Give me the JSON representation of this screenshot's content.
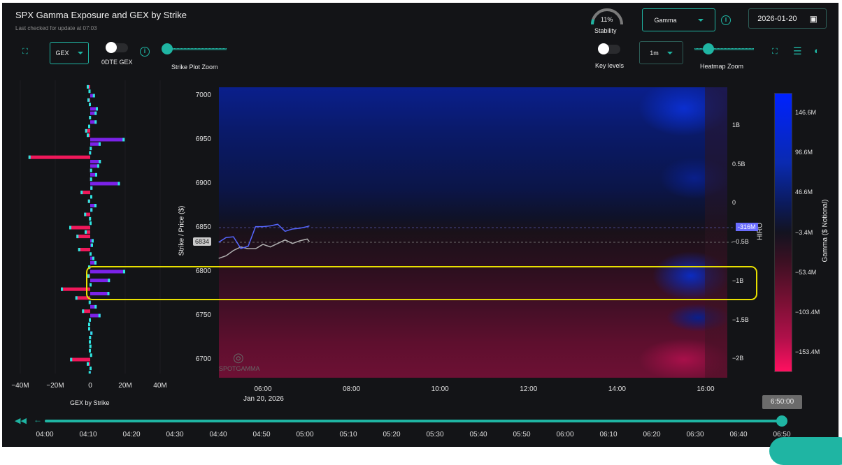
{
  "header": {
    "title": "SPX Gamma Exposure and GEX by Strike",
    "subtitle": "Last checked for update at 07:03"
  },
  "controls_left": {
    "gex_select": "GEX",
    "dte_toggle_label": "0DTE GEX",
    "dte_toggle_on": false,
    "strike_zoom_label": "Strike Plot Zoom",
    "info": "i"
  },
  "controls_right": {
    "stability_value": "11%",
    "stability_label": "Stability",
    "stability_fraction": 0.11,
    "gamma_select": "Gamma",
    "info": "i",
    "date": "2026-01-20",
    "key_levels_label": "Key levels",
    "key_levels_on": false,
    "interval_select": "1m",
    "heatmap_zoom_label": "Heatmap Zoom"
  },
  "colors": {
    "accent": "#1fb5a3",
    "positive_bar": "#7b22e8",
    "negative_bar": "#f0185a",
    "highlight": "#e8e000",
    "hiro_line": "#5566ff",
    "price_line": "#b0b0b0"
  },
  "gex_chart": {
    "type": "bar",
    "title": "GEX by Strike",
    "xlim": [
      -40,
      40
    ],
    "x_ticks": [
      "−40M",
      "−20M",
      "0",
      "20M",
      "40M"
    ],
    "strikes": [
      7010,
      7005,
      7000,
      6995,
      6990,
      6985,
      6980,
      6975,
      6970,
      6965,
      6960,
      6955,
      6950,
      6945,
      6940,
      6935,
      6930,
      6925,
      6920,
      6915,
      6910,
      6905,
      6900,
      6895,
      6890,
      6885,
      6880,
      6875,
      6870,
      6865,
      6860,
      6855,
      6850,
      6845,
      6840,
      6835,
      6830,
      6825,
      6820,
      6815,
      6810,
      6805,
      6800,
      6795,
      6790,
      6785,
      6780,
      6775,
      6770,
      6765,
      6760,
      6755,
      6750,
      6745,
      6740,
      6735,
      6730,
      6725,
      6720,
      6715,
      6710,
      6705,
      6700,
      6695,
      6690,
      6685,
      6680
    ],
    "values_M": [
      -2,
      -1,
      2.7,
      -1.6,
      -0.8,
      4.4,
      3.7,
      -0.7,
      3.7,
      -1.2,
      -2.9,
      -2,
      19.7,
      6,
      0.9,
      0.5,
      -35.3,
      6.1,
      5.2,
      -0.1,
      4,
      -0.1,
      17,
      1.3,
      -5.5,
      1.2,
      -1.3,
      3.6,
      1.3,
      -3.5,
      -0.7,
      0.8,
      -12,
      -3.2,
      -7.9,
      2,
      1.6,
      -6.9,
      -0.4,
      2.4,
      3.6,
      0,
      20,
      -1.6,
      11.3,
      -0.4,
      -16.8,
      11,
      -8.5,
      0.3,
      3.7,
      -4.7,
      5.9,
      0.4,
      -1.2,
      -1.2,
      1.3,
      0.5,
      0.4,
      -0.5,
      -0.8,
      -0.1,
      -11.5,
      -2,
      0.8,
      0.3,
      -0.4
    ]
  },
  "chart_data": {
    "type": "heatmap",
    "ylabel": "Strike / Price ($)",
    "y_ticks": [
      7000,
      6950,
      6900,
      6850,
      6800,
      6750,
      6700
    ],
    "x_ticks": [
      "06:00",
      "08:00",
      "10:00",
      "12:00",
      "14:00",
      "16:00"
    ],
    "x_date": "Jan 20, 2026",
    "y2label": "HIRO",
    "y2_ticks": [
      "1B",
      "0.5B",
      "0",
      "−0.5B",
      "−1B",
      "−1.5B",
      "−2B"
    ],
    "colorbar_label": "Gamma ($ Notional)",
    "colorbar_ticks": [
      "146.6M",
      "96.6M",
      "46.6M",
      "−3.4M",
      "−53.4M",
      "−103.4M",
      "−153.4M"
    ],
    "price_label": "6834",
    "hiro_label": "-316M",
    "price_series": {
      "times": [
        "05:00",
        "05:10",
        "05:20",
        "05:30",
        "05:40",
        "05:50",
        "06:00",
        "06:10",
        "06:20",
        "06:30",
        "06:40",
        "06:50",
        "07:00",
        "07:03"
      ],
      "values": [
        6815,
        6818,
        6824,
        6828,
        6826,
        6826,
        6831,
        6828,
        6832,
        6836,
        6832,
        6835,
        6837,
        6834
      ]
    },
    "hiro_series": {
      "times": [
        "05:00",
        "05:10",
        "05:20",
        "05:30",
        "05:40",
        "05:50",
        "06:00",
        "06:10",
        "06:20",
        "06:30",
        "06:40",
        "06:50",
        "07:00",
        "07:03"
      ],
      "values_B": [
        -0.5,
        -0.44,
        -0.43,
        -0.58,
        -0.55,
        -0.3,
        -0.3,
        -0.29,
        -0.27,
        -0.36,
        -0.33,
        -0.32,
        -0.3,
        -0.29
      ]
    },
    "highlight_range": [
      6775,
      6810
    ]
  },
  "timeline": {
    "current": "6:50:00",
    "value_fraction": 1,
    "labels": [
      "04:00",
      "04:10",
      "04:20",
      "04:30",
      "04:40",
      "04:50",
      "05:00",
      "05:10",
      "05:20",
      "05:30",
      "05:40",
      "05:50",
      "06:00",
      "06:10",
      "06:20",
      "06:30",
      "06:40",
      "06:50"
    ]
  },
  "watermark": "SPOTGAMMA"
}
